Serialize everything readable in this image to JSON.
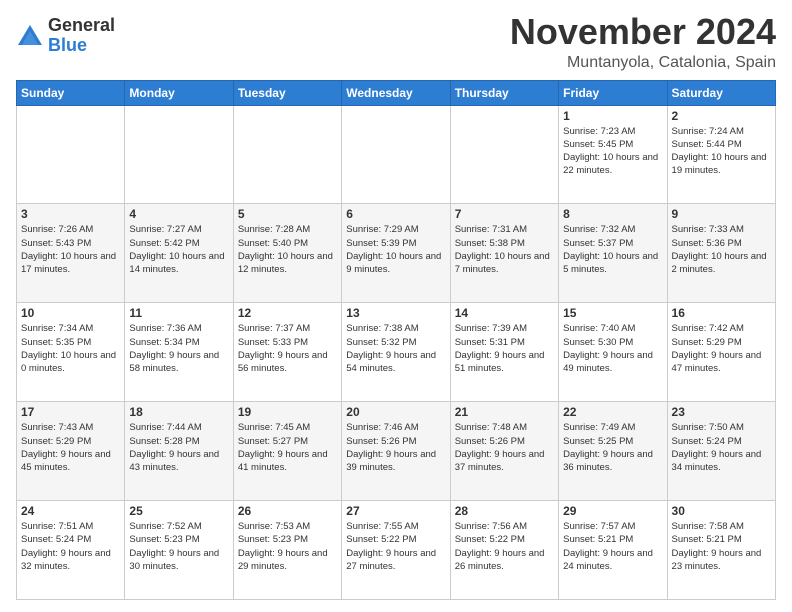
{
  "logo": {
    "general": "General",
    "blue": "Blue"
  },
  "title": "November 2024",
  "location": "Muntanyola, Catalonia, Spain",
  "days_header": [
    "Sunday",
    "Monday",
    "Tuesday",
    "Wednesday",
    "Thursday",
    "Friday",
    "Saturday"
  ],
  "weeks": [
    [
      {
        "day": "",
        "info": ""
      },
      {
        "day": "",
        "info": ""
      },
      {
        "day": "",
        "info": ""
      },
      {
        "day": "",
        "info": ""
      },
      {
        "day": "",
        "info": ""
      },
      {
        "day": "1",
        "info": "Sunrise: 7:23 AM\nSunset: 5:45 PM\nDaylight: 10 hours\nand 22 minutes."
      },
      {
        "day": "2",
        "info": "Sunrise: 7:24 AM\nSunset: 5:44 PM\nDaylight: 10 hours\nand 19 minutes."
      }
    ],
    [
      {
        "day": "3",
        "info": "Sunrise: 7:26 AM\nSunset: 5:43 PM\nDaylight: 10 hours\nand 17 minutes."
      },
      {
        "day": "4",
        "info": "Sunrise: 7:27 AM\nSunset: 5:42 PM\nDaylight: 10 hours\nand 14 minutes."
      },
      {
        "day": "5",
        "info": "Sunrise: 7:28 AM\nSunset: 5:40 PM\nDaylight: 10 hours\nand 12 minutes."
      },
      {
        "day": "6",
        "info": "Sunrise: 7:29 AM\nSunset: 5:39 PM\nDaylight: 10 hours\nand 9 minutes."
      },
      {
        "day": "7",
        "info": "Sunrise: 7:31 AM\nSunset: 5:38 PM\nDaylight: 10 hours\nand 7 minutes."
      },
      {
        "day": "8",
        "info": "Sunrise: 7:32 AM\nSunset: 5:37 PM\nDaylight: 10 hours\nand 5 minutes."
      },
      {
        "day": "9",
        "info": "Sunrise: 7:33 AM\nSunset: 5:36 PM\nDaylight: 10 hours\nand 2 minutes."
      }
    ],
    [
      {
        "day": "10",
        "info": "Sunrise: 7:34 AM\nSunset: 5:35 PM\nDaylight: 10 hours\nand 0 minutes."
      },
      {
        "day": "11",
        "info": "Sunrise: 7:36 AM\nSunset: 5:34 PM\nDaylight: 9 hours\nand 58 minutes."
      },
      {
        "day": "12",
        "info": "Sunrise: 7:37 AM\nSunset: 5:33 PM\nDaylight: 9 hours\nand 56 minutes."
      },
      {
        "day": "13",
        "info": "Sunrise: 7:38 AM\nSunset: 5:32 PM\nDaylight: 9 hours\nand 54 minutes."
      },
      {
        "day": "14",
        "info": "Sunrise: 7:39 AM\nSunset: 5:31 PM\nDaylight: 9 hours\nand 51 minutes."
      },
      {
        "day": "15",
        "info": "Sunrise: 7:40 AM\nSunset: 5:30 PM\nDaylight: 9 hours\nand 49 minutes."
      },
      {
        "day": "16",
        "info": "Sunrise: 7:42 AM\nSunset: 5:29 PM\nDaylight: 9 hours\nand 47 minutes."
      }
    ],
    [
      {
        "day": "17",
        "info": "Sunrise: 7:43 AM\nSunset: 5:29 PM\nDaylight: 9 hours\nand 45 minutes."
      },
      {
        "day": "18",
        "info": "Sunrise: 7:44 AM\nSunset: 5:28 PM\nDaylight: 9 hours\nand 43 minutes."
      },
      {
        "day": "19",
        "info": "Sunrise: 7:45 AM\nSunset: 5:27 PM\nDaylight: 9 hours\nand 41 minutes."
      },
      {
        "day": "20",
        "info": "Sunrise: 7:46 AM\nSunset: 5:26 PM\nDaylight: 9 hours\nand 39 minutes."
      },
      {
        "day": "21",
        "info": "Sunrise: 7:48 AM\nSunset: 5:26 PM\nDaylight: 9 hours\nand 37 minutes."
      },
      {
        "day": "22",
        "info": "Sunrise: 7:49 AM\nSunset: 5:25 PM\nDaylight: 9 hours\nand 36 minutes."
      },
      {
        "day": "23",
        "info": "Sunrise: 7:50 AM\nSunset: 5:24 PM\nDaylight: 9 hours\nand 34 minutes."
      }
    ],
    [
      {
        "day": "24",
        "info": "Sunrise: 7:51 AM\nSunset: 5:24 PM\nDaylight: 9 hours\nand 32 minutes."
      },
      {
        "day": "25",
        "info": "Sunrise: 7:52 AM\nSunset: 5:23 PM\nDaylight: 9 hours\nand 30 minutes."
      },
      {
        "day": "26",
        "info": "Sunrise: 7:53 AM\nSunset: 5:23 PM\nDaylight: 9 hours\nand 29 minutes."
      },
      {
        "day": "27",
        "info": "Sunrise: 7:55 AM\nSunset: 5:22 PM\nDaylight: 9 hours\nand 27 minutes."
      },
      {
        "day": "28",
        "info": "Sunrise: 7:56 AM\nSunset: 5:22 PM\nDaylight: 9 hours\nand 26 minutes."
      },
      {
        "day": "29",
        "info": "Sunrise: 7:57 AM\nSunset: 5:21 PM\nDaylight: 9 hours\nand 24 minutes."
      },
      {
        "day": "30",
        "info": "Sunrise: 7:58 AM\nSunset: 5:21 PM\nDaylight: 9 hours\nand 23 minutes."
      }
    ]
  ]
}
